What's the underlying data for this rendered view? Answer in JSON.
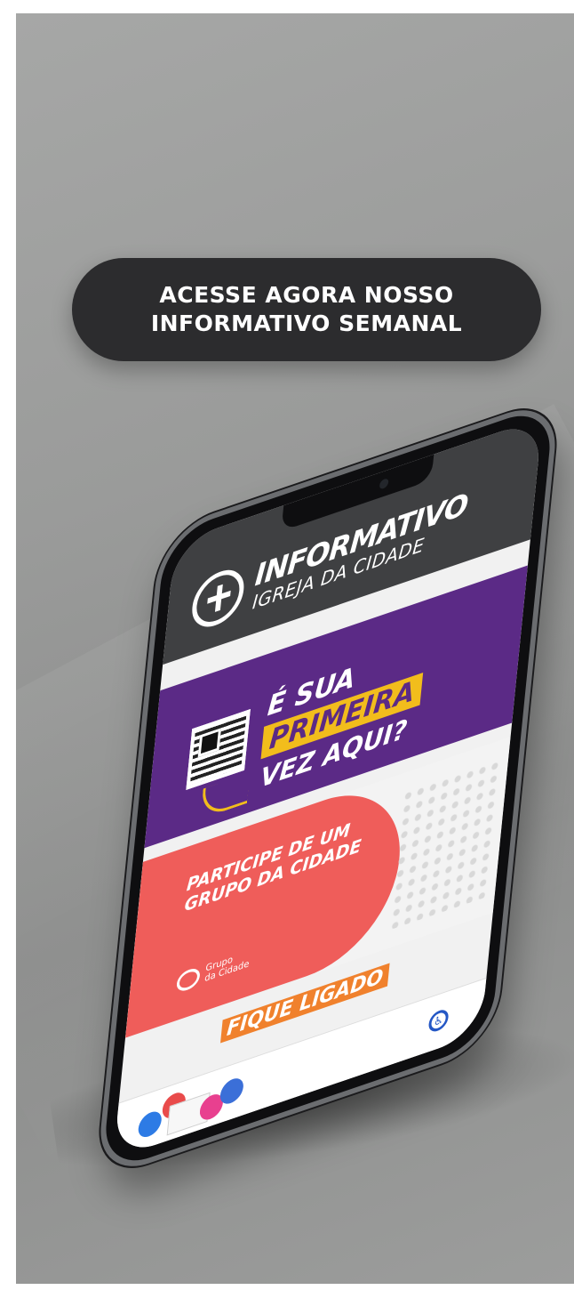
{
  "cta": {
    "line1": "ACESSE AGORA NOSSO",
    "line2": "INFORMATIVO SEMANAL"
  },
  "phone": {
    "header": {
      "title": "INFORMATIVO",
      "subtitle": "IGREJA DA CIDADE",
      "logo_icon": "church-cross-logo"
    },
    "first_visit_banner": {
      "line1": "É SUA",
      "line2": "PRIMEIRA",
      "line3": "VEZ AQUI?",
      "qr_icon": "qr-code-icon",
      "colors": {
        "background": "#5b2a86",
        "highlight": "#f2bd1c"
      }
    },
    "group_banner": {
      "title_line1": "PARTICIPE DE UM",
      "title_line2": "GRUPO DA CIDADE",
      "logo_line1": "Grupo",
      "logo_line2": "da Cidade",
      "colors": {
        "accent": "#ef5d5a"
      }
    },
    "fique_ligado": {
      "title": "FIQUE LIGADO",
      "colors": {
        "accent": "#f0812d"
      }
    },
    "bottom_bar": {
      "social_icon": "social-media-icons",
      "accessibility_icon": "accessibility-icon"
    }
  }
}
